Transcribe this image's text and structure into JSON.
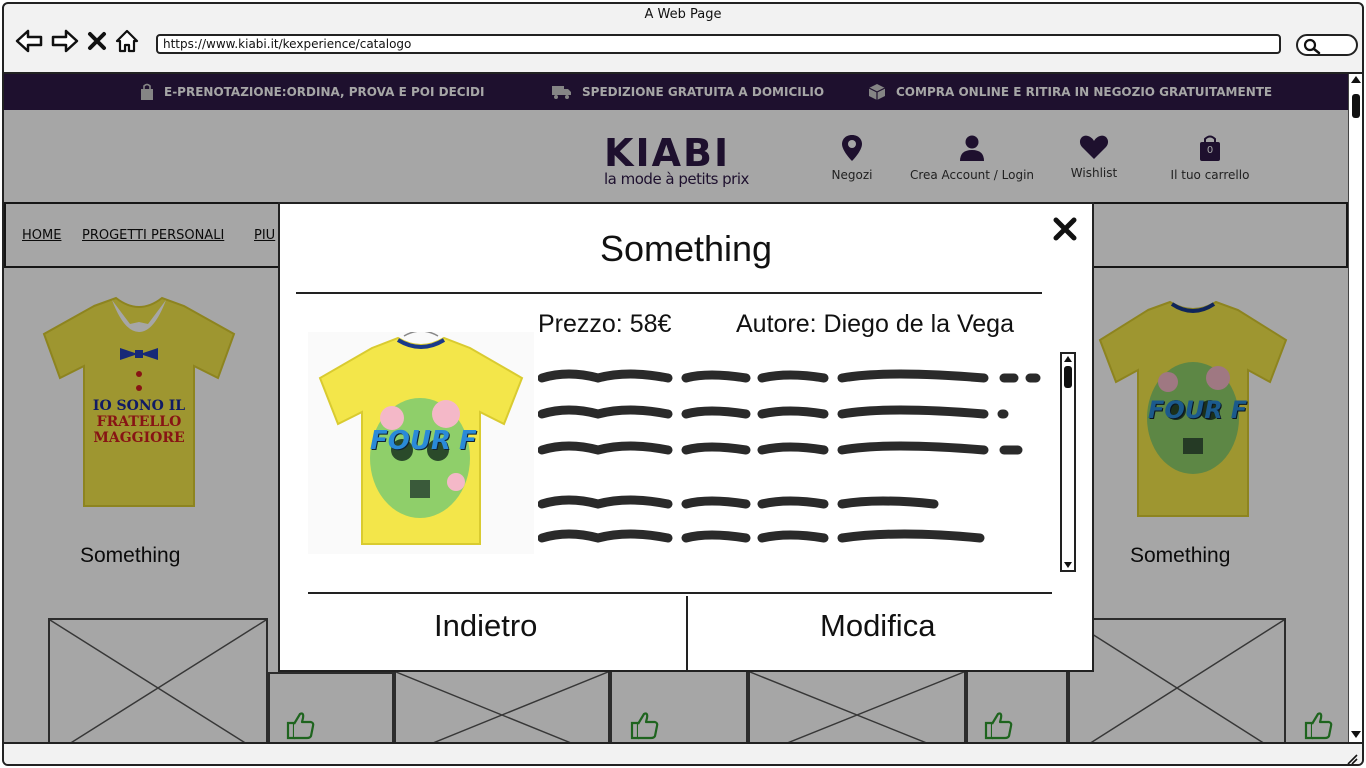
{
  "browser": {
    "title": "A Web Page",
    "url": "https://www.kiabi.it/kexperience/catalogo"
  },
  "promo": {
    "items": [
      {
        "icon": "bag-icon",
        "text": "E-PRENOTAZIONE:ORDINA, PROVA E POI DECIDI"
      },
      {
        "icon": "truck-icon",
        "text": "SPEDIZIONE GRATUITA A DOMICILIO"
      },
      {
        "icon": "box-icon",
        "text": "COMPRA ONLINE E RITIRA IN NEGOZIO GRATUITAMENTE"
      }
    ]
  },
  "header": {
    "logo_word": "KIABI",
    "logo_tagline": "la mode à petits prix",
    "negozi": "Negozi",
    "account": "Crea Account / Login",
    "wishlist": "Wishlist",
    "cart": "Il tuo carrello",
    "cart_count": "0"
  },
  "menu": {
    "items": [
      "HOME",
      "PROGETTI PERSONALI",
      "PIU"
    ]
  },
  "grid": {
    "cards": [
      {
        "caption": "Something",
        "shirt_text": [
          "IO SONO IL",
          "FRATELLO",
          "MAGGIORE"
        ]
      },
      {
        "caption": "Something",
        "shirt_text": [
          "FOUR",
          "F"
        ]
      }
    ]
  },
  "modal": {
    "title": "Something",
    "price_label": "Prezzo: 58€",
    "author_label": "Autore: Diego de la Vega",
    "shirt_text": [
      "FOUR",
      "F"
    ],
    "back_button": "Indietro",
    "edit_button": "Modifica"
  },
  "colors": {
    "brand": "#2e1a47",
    "shirt_yellow": "#f3e64a",
    "thumb_green": "#2e9a2e"
  }
}
